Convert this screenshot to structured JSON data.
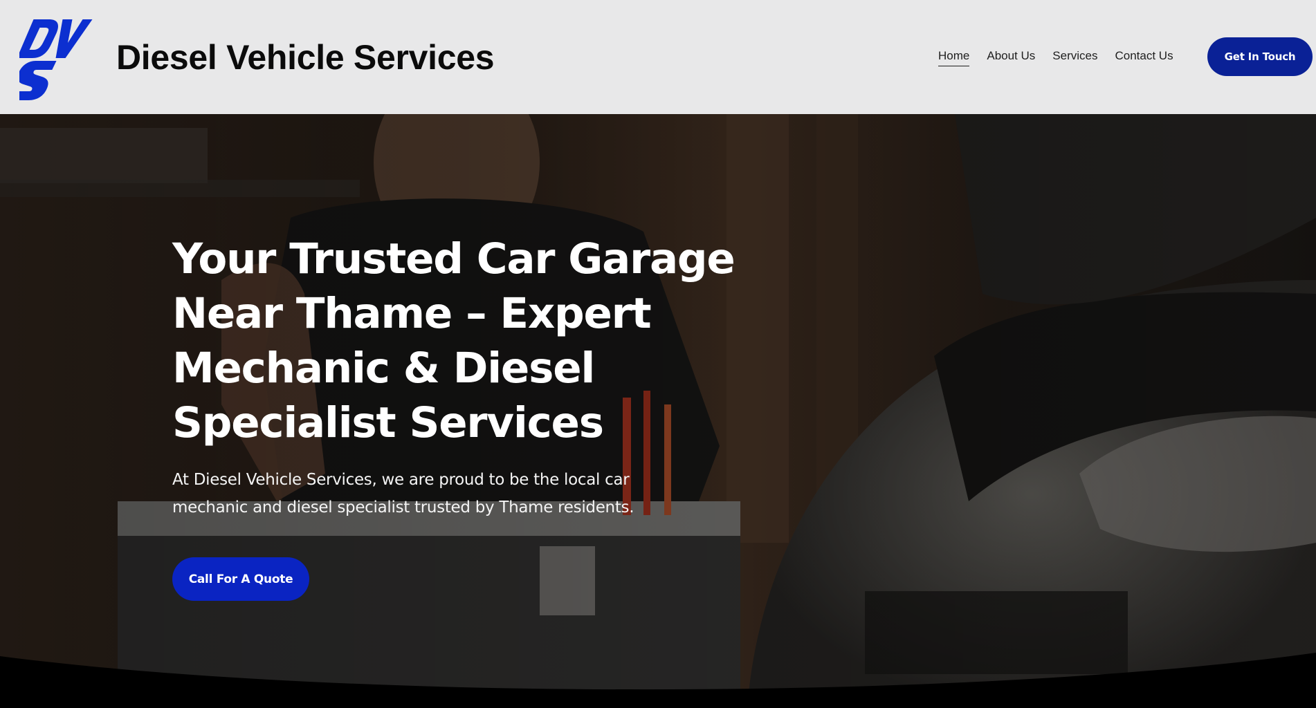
{
  "header": {
    "logo_alt": "DVS",
    "brand_name": "Diesel Vehicle Services",
    "nav": [
      {
        "label": "Home",
        "active": true
      },
      {
        "label": "About Us",
        "active": false
      },
      {
        "label": "Services",
        "active": false
      },
      {
        "label": "Contact Us",
        "active": false
      }
    ],
    "cta_label": "Get In Touch"
  },
  "hero": {
    "title_lines": [
      "Your Trusted Car Garage",
      "Near Thame – Expert",
      "Mechanic & Diesel",
      "Specialist Services"
    ],
    "subtitle": "At Diesel Vehicle Services, we are proud to be the local car mechanic and diesel specialist trusted by Thame residents.",
    "cta_label": "Call For A Quote"
  },
  "colors": {
    "header_bg": "#e8e8e9",
    "brand_blue": "#0a2196",
    "hero_cta_blue": "#0a24c2",
    "logo_blue": "#0c2fd0"
  },
  "icons": {
    "logo": "dvs-logo-icon"
  }
}
